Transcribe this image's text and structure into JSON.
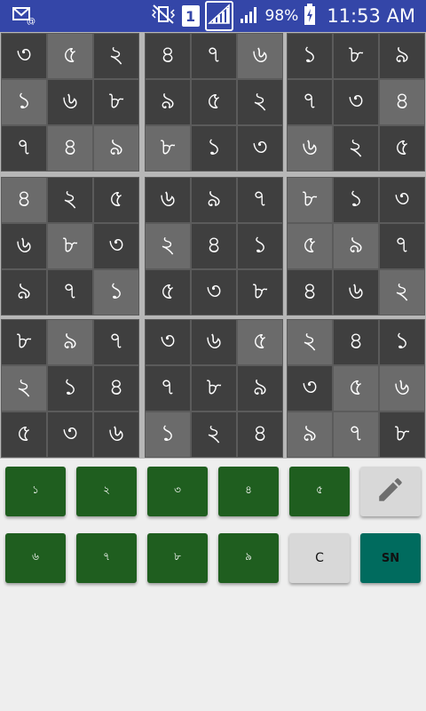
{
  "status_bar": {
    "battery_percent": "98%",
    "time": "11:53 AM",
    "sim_label": "1",
    "icons": [
      "mail-at-icon",
      "mute-vibrate-icon",
      "sim-icon",
      "signal-icon",
      "signal-icon",
      "battery-charging-icon"
    ]
  },
  "board": {
    "cells": [
      [
        "৩",
        "৫",
        "২",
        "৪",
        "৭",
        "৬",
        "১",
        "৮",
        "৯"
      ],
      [
        "১",
        "৬",
        "৮",
        "৯",
        "৫",
        "২",
        "৭",
        "৩",
        "৪"
      ],
      [
        "৭",
        "৪",
        "৯",
        "৮",
        "১",
        "৩",
        "৬",
        "২",
        "৫"
      ],
      [
        "৪",
        "২",
        "৫",
        "৬",
        "৯",
        "৭",
        "৮",
        "১",
        "৩"
      ],
      [
        "৬",
        "৮",
        "৩",
        "২",
        "৪",
        "১",
        "৫",
        "৯",
        "৭"
      ],
      [
        "৯",
        "৭",
        "১",
        "৫",
        "৩",
        "৮",
        "৪",
        "৬",
        "২"
      ],
      [
        "৮",
        "৯",
        "৭",
        "৩",
        "৬",
        "৫",
        "২",
        "৪",
        "১"
      ],
      [
        "২",
        "১",
        "৪",
        "৭",
        "৮",
        "৯",
        "৩",
        "৫",
        "৬"
      ],
      [
        "৫",
        "৩",
        "৬",
        "১",
        "২",
        "৪",
        "৯",
        "৭",
        "৮"
      ]
    ],
    "shade": [
      [
        "d",
        "l",
        "d",
        "d",
        "d",
        "l",
        "d",
        "d",
        "d"
      ],
      [
        "l",
        "d",
        "d",
        "d",
        "d",
        "d",
        "d",
        "d",
        "l"
      ],
      [
        "d",
        "l",
        "l",
        "l",
        "d",
        "d",
        "l",
        "d",
        "d"
      ],
      [
        "l",
        "d",
        "d",
        "d",
        "d",
        "d",
        "l",
        "d",
        "d"
      ],
      [
        "d",
        "l",
        "d",
        "l",
        "d",
        "d",
        "l",
        "l",
        "d"
      ],
      [
        "d",
        "d",
        "l",
        "d",
        "d",
        "d",
        "d",
        "d",
        "l"
      ],
      [
        "d",
        "l",
        "d",
        "d",
        "d",
        "l",
        "l",
        "d",
        "d"
      ],
      [
        "l",
        "d",
        "d",
        "d",
        "d",
        "d",
        "d",
        "l",
        "l"
      ],
      [
        "d",
        "d",
        "d",
        "l",
        "d",
        "d",
        "l",
        "l",
        "d"
      ]
    ],
    "colors": {
      "dark": "#3f3f3f",
      "light": "#6b6b6b",
      "divider": "#b7b7b7"
    }
  },
  "keypad": {
    "row1": [
      "১",
      "২",
      "৩",
      "৪",
      "৫"
    ],
    "row2": [
      "৬",
      "৭",
      "৮",
      "৯"
    ],
    "pencil_icon": "pencil-icon",
    "clear_label": "C",
    "solve_label": "SN",
    "colors": {
      "number": "#1f5e1f",
      "tool": "#d8d8d8",
      "solve": "#006b5e"
    }
  }
}
